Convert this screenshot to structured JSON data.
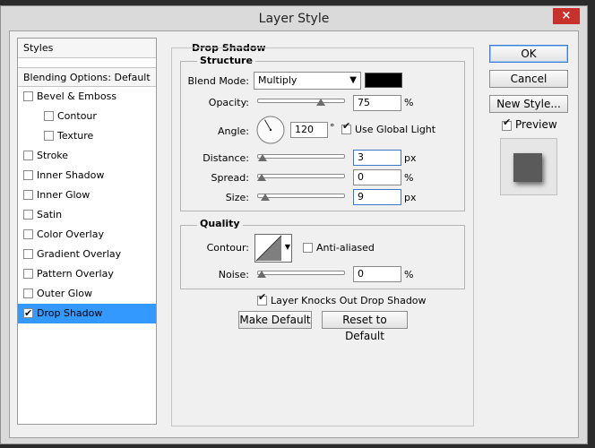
{
  "window": {
    "title": "Layer Style",
    "close_glyph": "×"
  },
  "styles_panel": {
    "header": "Styles",
    "blending_options": "Blending Options: Default",
    "items": [
      {
        "label": "Bevel & Emboss",
        "checked": false,
        "indent": false
      },
      {
        "label": "Contour",
        "checked": false,
        "indent": true
      },
      {
        "label": "Texture",
        "checked": false,
        "indent": true
      },
      {
        "label": "Stroke",
        "checked": false,
        "indent": false
      },
      {
        "label": "Inner Shadow",
        "checked": false,
        "indent": false
      },
      {
        "label": "Inner Glow",
        "checked": false,
        "indent": false
      },
      {
        "label": "Satin",
        "checked": false,
        "indent": false
      },
      {
        "label": "Color Overlay",
        "checked": false,
        "indent": false
      },
      {
        "label": "Gradient Overlay",
        "checked": false,
        "indent": false
      },
      {
        "label": "Pattern Overlay",
        "checked": false,
        "indent": false
      },
      {
        "label": "Outer Glow",
        "checked": false,
        "indent": false
      },
      {
        "label": "Drop Shadow",
        "checked": true,
        "indent": false,
        "selected": true
      }
    ]
  },
  "drop_shadow": {
    "title": "Drop Shadow",
    "structure": {
      "title": "Structure",
      "blend_mode_label": "Blend Mode:",
      "blend_mode_value": "Multiply",
      "shadow_color": "#000000",
      "opacity_label": "Opacity:",
      "opacity_value": "75",
      "opacity_unit": "%",
      "opacity_fraction": 0.75,
      "angle_label": "Angle:",
      "angle_value": "120",
      "angle_unit": "°",
      "use_global_light_label": "Use Global Light",
      "use_global_light_checked": true,
      "distance_label": "Distance:",
      "distance_value": "3",
      "distance_unit": "px",
      "distance_fraction": 0.01,
      "spread_label": "Spread:",
      "spread_value": "0",
      "spread_unit": "%",
      "spread_fraction": 0.0,
      "size_label": "Size:",
      "size_value": "9",
      "size_unit": "px",
      "size_fraction": 0.04
    },
    "quality": {
      "title": "Quality",
      "contour_label": "Contour:",
      "anti_aliased_label": "Anti-aliased",
      "anti_aliased_checked": false,
      "noise_label": "Noise:",
      "noise_value": "0",
      "noise_unit": "%",
      "noise_fraction": 0.0
    },
    "knocks_out_label": "Layer Knocks Out Drop Shadow",
    "knocks_out_checked": true,
    "make_default_label": "Make Default",
    "reset_default_label": "Reset to Default"
  },
  "actions": {
    "ok_label": "OK",
    "cancel_label": "Cancel",
    "new_style_label": "New Style...",
    "preview_label": "Preview",
    "preview_checked": true
  },
  "colors": {
    "selection": "#3399ff",
    "close_button": "#c7302b",
    "dialog_bg": "#f0f0f0"
  }
}
